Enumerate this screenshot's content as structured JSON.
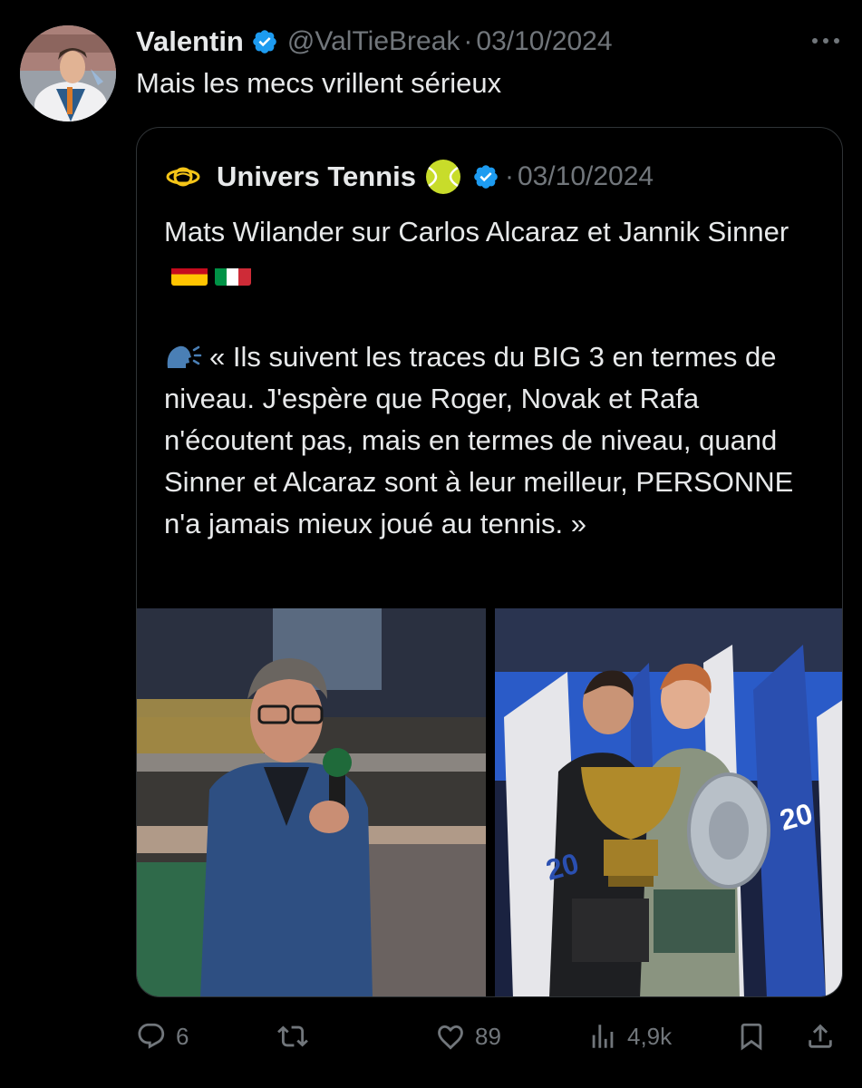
{
  "tweet": {
    "author_name": "Valentin",
    "handle": "@ValTieBreak",
    "separator": "·",
    "date": "03/10/2024",
    "text": "Mais les mecs vrillent sérieux"
  },
  "quote": {
    "author_name": "Univers Tennis",
    "separator": "·",
    "date": "03/10/2024",
    "text_line1": "Mats Wilander sur Carlos Alcaraz et Jannik Sinner",
    "text_quote": "« Ils suivent les traces du BIG 3 en termes de niveau. J'espère que Roger, Novak et Rafa n'écoutent pas, mais en termes de niveau, quand Sinner et Alcaraz sont à leur meilleur, PERSONNE n'a jamais mieux joué au tennis. »"
  },
  "photo_right": {
    "flag_text_1": "20",
    "flag_text_2": "20"
  },
  "actions": {
    "replies": "6",
    "retweets": "",
    "likes": "89",
    "views": "4,9k"
  },
  "icons": [
    "verified-badge-icon",
    "more-icon",
    "univers-tennis-logo-icon",
    "tennis-ball-icon",
    "spain-flag-icon",
    "italy-flag-icon",
    "speaking-head-icon",
    "reply-icon",
    "retweet-icon",
    "like-icon",
    "views-icon",
    "bookmark-icon",
    "share-icon"
  ],
  "colors": {
    "background": "#000000",
    "text": "#e7e9ea",
    "muted": "#71767b",
    "verified": "#1d9bf0",
    "border": "#2f3336"
  }
}
